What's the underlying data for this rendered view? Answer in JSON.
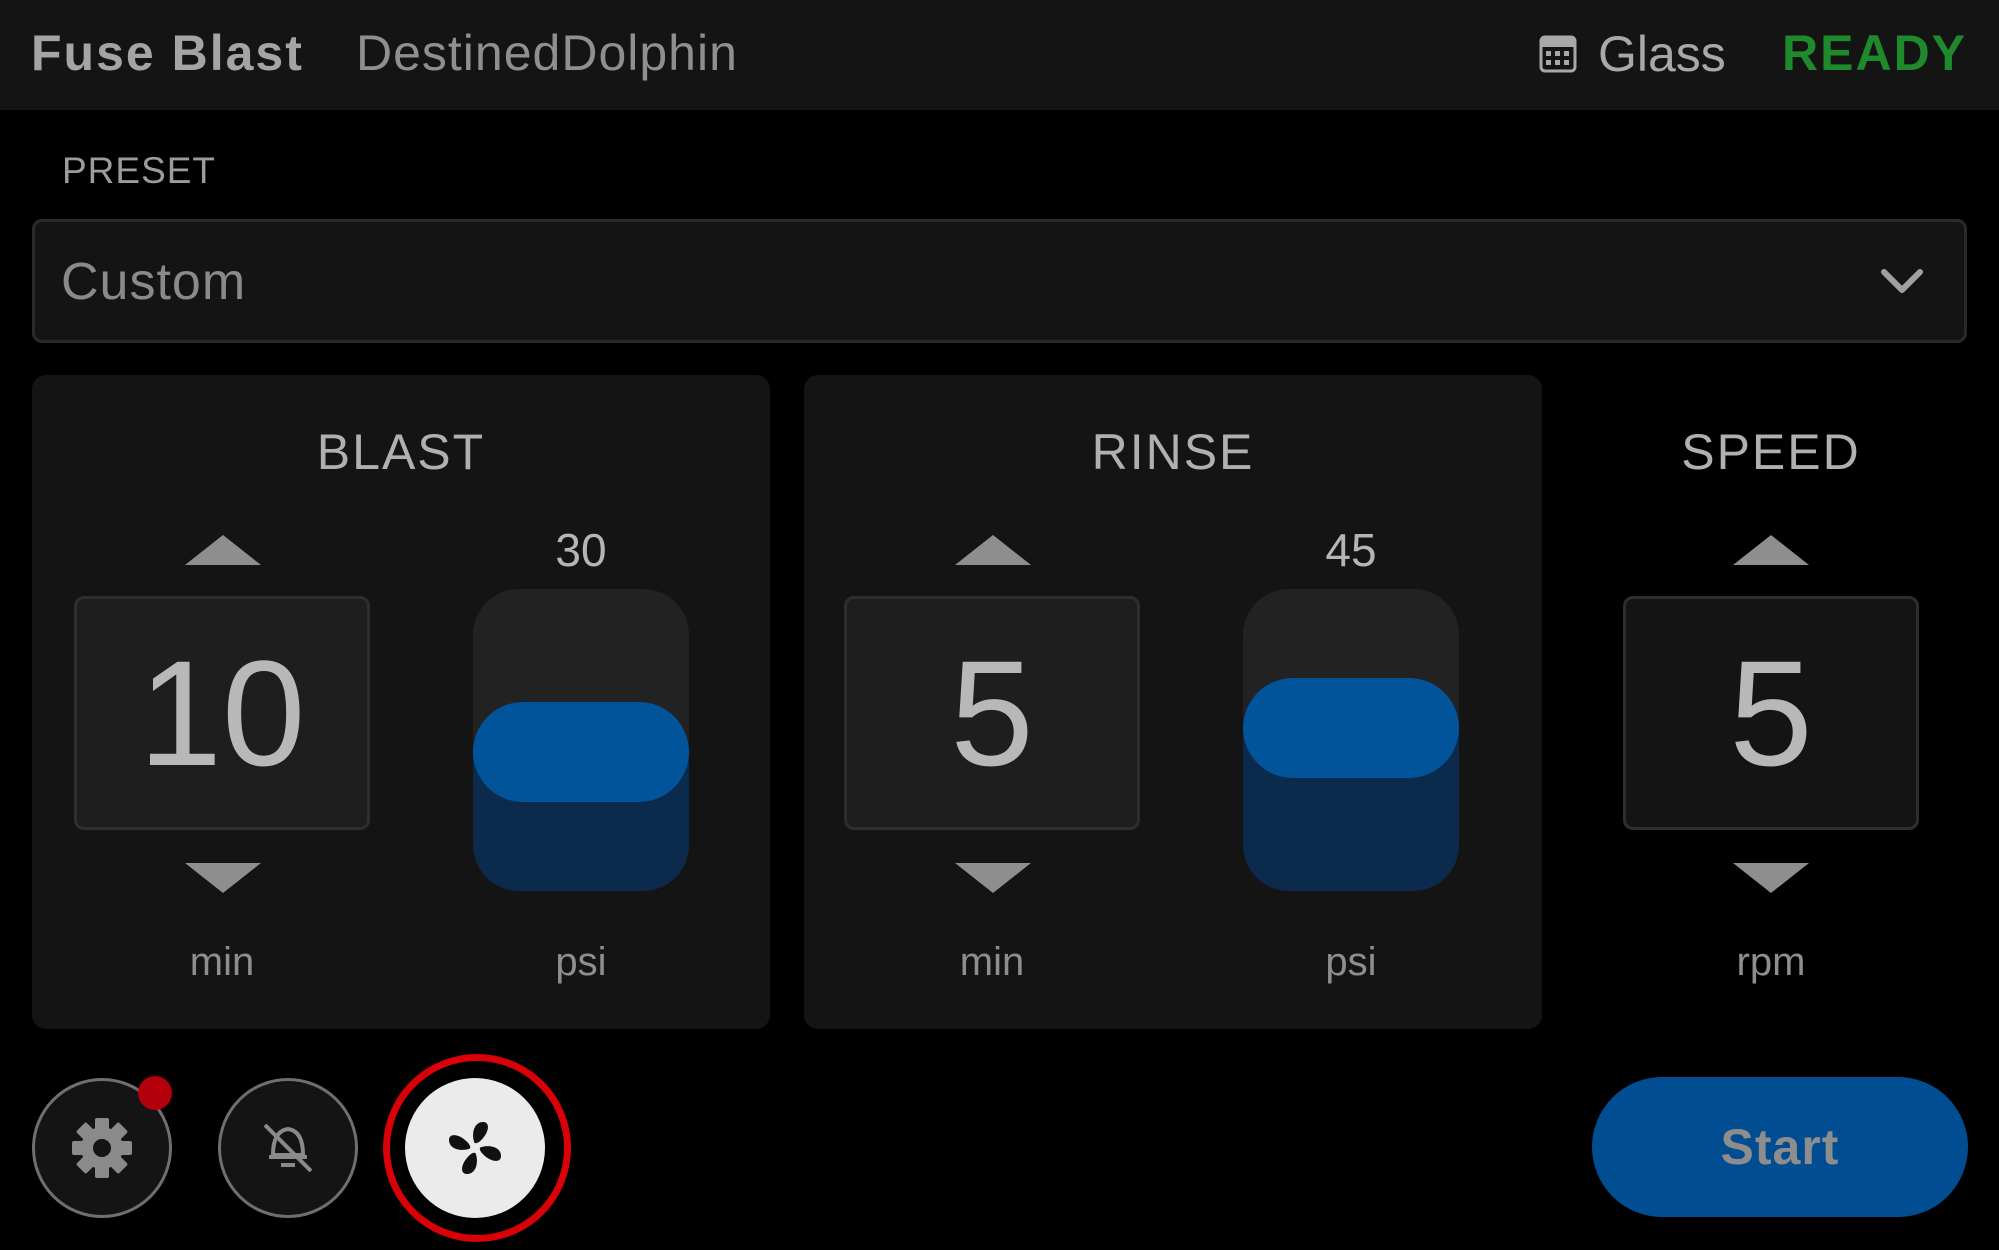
{
  "header": {
    "app_title": "Fuse Blast",
    "device_name": "DestinedDolphin",
    "material_icon": "material-grid-icon",
    "material": "Glass",
    "status": "READY",
    "status_color": "#1f8a2c"
  },
  "preset": {
    "label": "PRESET",
    "selected": "Custom"
  },
  "blast": {
    "title": "BLAST",
    "time_value": "10",
    "time_unit": "min",
    "pressure_value": "30",
    "pressure_fraction": 0.3,
    "pressure_unit": "psi"
  },
  "rinse": {
    "title": "RINSE",
    "time_value": "5",
    "time_unit": "min",
    "pressure_value": "45",
    "pressure_fraction": 0.45,
    "pressure_unit": "psi"
  },
  "speed": {
    "title": "SPEED",
    "value": "5",
    "unit": "rpm"
  },
  "footer": {
    "settings_icon": "gear-icon",
    "light_icon": "light-off-icon",
    "fan_icon": "fan-icon",
    "start_label": "Start",
    "accent_color": "#01539a",
    "highlight_color": "#d90008"
  }
}
